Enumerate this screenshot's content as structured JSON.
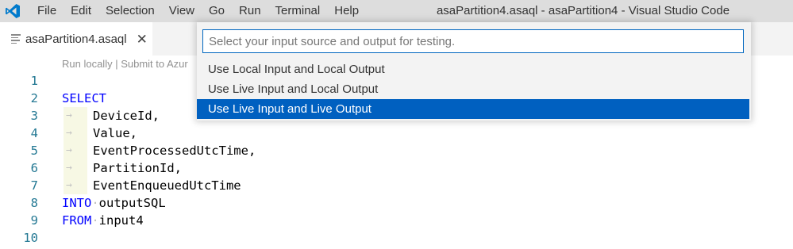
{
  "titlebar": {
    "menu": [
      "File",
      "Edit",
      "Selection",
      "View",
      "Go",
      "Run",
      "Terminal",
      "Help"
    ],
    "window_title": "asaPartition4.asaql - asaPartition4 - Visual Studio Code",
    "logo_icon": "vscode-logo-icon",
    "logo_color": "#007acc"
  },
  "tab": {
    "label": "asaPartition4.asaql",
    "close": "✕",
    "icon": "file-lines-icon"
  },
  "codelens": {
    "run_locally": "Run locally",
    "separator": " | ",
    "submit": "Submit to Azur"
  },
  "editor": {
    "lines": [
      {
        "num": "1",
        "kw": "",
        "text": "",
        "indent": false
      },
      {
        "num": "2",
        "kw": "SELECT",
        "text": "",
        "indent": false
      },
      {
        "num": "3",
        "kw": "",
        "text": "DeviceId,",
        "indent": true
      },
      {
        "num": "4",
        "kw": "",
        "text": "Value,",
        "indent": true
      },
      {
        "num": "5",
        "kw": "",
        "text": "EventProcessedUtcTime,",
        "indent": true
      },
      {
        "num": "6",
        "kw": "",
        "text": "PartitionId,",
        "indent": true
      },
      {
        "num": "7",
        "kw": "",
        "text": "EventEnqueuedUtcTime",
        "indent": true
      },
      {
        "num": "8",
        "kw": "INTO",
        "text": "outputSQL",
        "indent": false
      },
      {
        "num": "9",
        "kw": "FROM",
        "text": "input4",
        "indent": false
      },
      {
        "num": "10",
        "kw": "",
        "text": "",
        "indent": false
      }
    ]
  },
  "quickpick": {
    "placeholder": "Select your input source and output for testing.",
    "items": [
      {
        "label": "Use Local Input and Local Output",
        "selected": false
      },
      {
        "label": "Use Live Input and Local Output",
        "selected": false
      },
      {
        "label": "Use Live Input and Live Output",
        "selected": true
      }
    ],
    "accent": "#0060c0"
  }
}
